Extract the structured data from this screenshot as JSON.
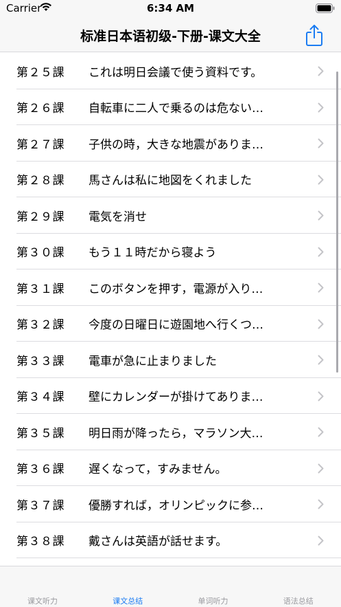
{
  "status_bar": {
    "carrier": "Carrier",
    "time": "6:34 AM"
  },
  "nav": {
    "title": "标准日本语初级-下册-课文大全",
    "share_icon": "share-icon"
  },
  "colors": {
    "accent": "#1b7cf2",
    "inactive_tab": "#9a9a9f",
    "separator": "#dcdce0",
    "chevron": "#c4c4c8"
  },
  "lessons": [
    {
      "number": "第２５課",
      "title": "これは明日会議で使う資料です。"
    },
    {
      "number": "第２６課",
      "title": "自転車に二人で乗るのは危ない…"
    },
    {
      "number": "第２７課",
      "title": "子供の時，大きな地震がありま…"
    },
    {
      "number": "第２８課",
      "title": "馬さんは私に地図をくれました"
    },
    {
      "number": "第２９課",
      "title": "電気を消せ"
    },
    {
      "number": "第３０課",
      "title": "もう１１時だから寝よう"
    },
    {
      "number": "第３１課",
      "title": "このボタンを押す，電源が入り…"
    },
    {
      "number": "第３２課",
      "title": "今度の日曜日に遊園地へ行くつ…"
    },
    {
      "number": "第３３課",
      "title": "電車が急に止まりました"
    },
    {
      "number": "第３４課",
      "title": "壁にカレンダーが掛けてありま…"
    },
    {
      "number": "第３５課",
      "title": "明日雨が降ったら，マラソン大…"
    },
    {
      "number": "第３６課",
      "title": "遅くなって，すみません。"
    },
    {
      "number": "第３７課",
      "title": "優勝すれば，オリンピックに参…"
    },
    {
      "number": "第３８課",
      "title": "戴さんは英語が話せます。"
    }
  ],
  "tabs": [
    {
      "label": "课文听力",
      "active": false
    },
    {
      "label": "课文总结",
      "active": true
    },
    {
      "label": "单词听力",
      "active": false
    },
    {
      "label": "语法总结",
      "active": false
    }
  ]
}
